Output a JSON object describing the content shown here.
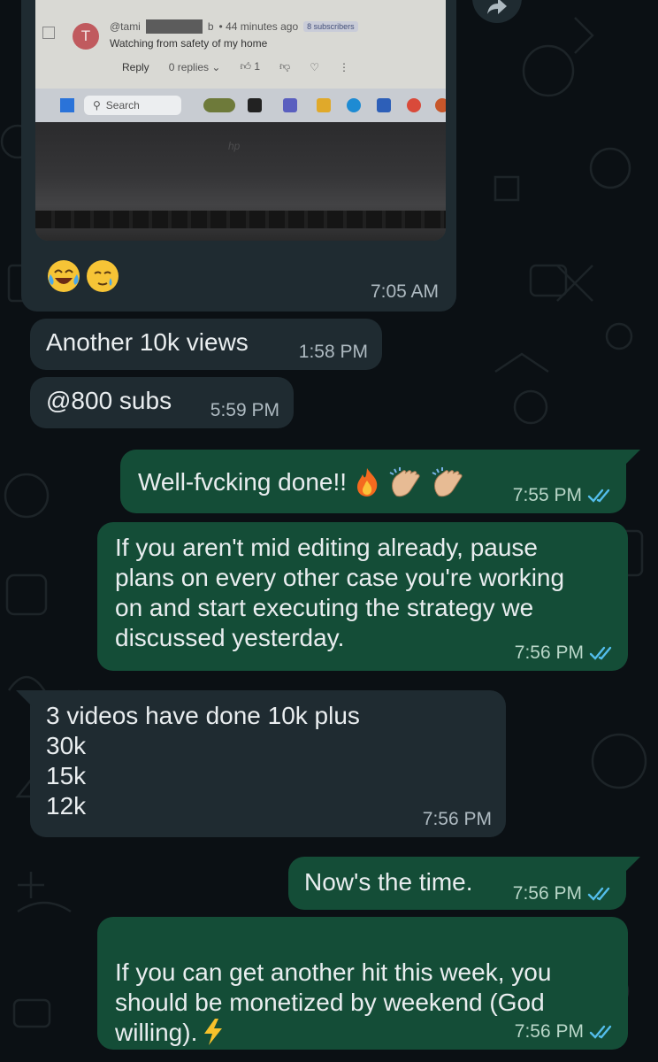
{
  "photo_message": {
    "screenshot": {
      "avatar_letter": "T",
      "handle_prefix": "@tami",
      "handle_suffix": "b",
      "time_ago": "• 44 minutes ago",
      "badge": "8 subscribers",
      "comment": "Watching from safety of my home",
      "reply": "Reply",
      "replies": "0 replies",
      "likes": "1",
      "search": "Search",
      "laptop_brand": "hp"
    },
    "emojis": [
      "face-with-tears-of-joy",
      "smiling-face-with-tear"
    ],
    "time": "7:05 AM"
  },
  "messages": [
    {
      "dir": "in",
      "text": "Another 10k views",
      "time": "1:58 PM"
    },
    {
      "dir": "in",
      "text": "@800 subs",
      "time": "5:59 PM"
    },
    {
      "dir": "out",
      "text": "Well-fvcking done!!",
      "emojis": [
        "fire",
        "clapping-hands",
        "clapping-hands"
      ],
      "time": "7:55 PM",
      "status": "read"
    },
    {
      "dir": "out",
      "text": "If you aren't mid editing already, pause\nplans on every other case you're working\non and start executing the strategy we\ndiscussed yesterday.",
      "time": "7:56 PM",
      "status": "read"
    },
    {
      "dir": "in",
      "text": "3 videos have done 10k plus\n30k\n15k\n12k",
      "time": "7:56 PM"
    },
    {
      "dir": "out",
      "text": "Now's the time.",
      "time": "7:56 PM",
      "status": "read"
    },
    {
      "dir": "out",
      "text": "If you can get another hit this week, you\nshould be monetized by weekend (God\nwilling).",
      "emojis": [
        "high-voltage"
      ],
      "time": "7:56 PM",
      "status": "read"
    }
  ],
  "colors": {
    "background": "#0b1014",
    "incoming_bubble": "#1f2b31",
    "outgoing_bubble": "#144d37",
    "read_tick": "#53bdeb"
  }
}
